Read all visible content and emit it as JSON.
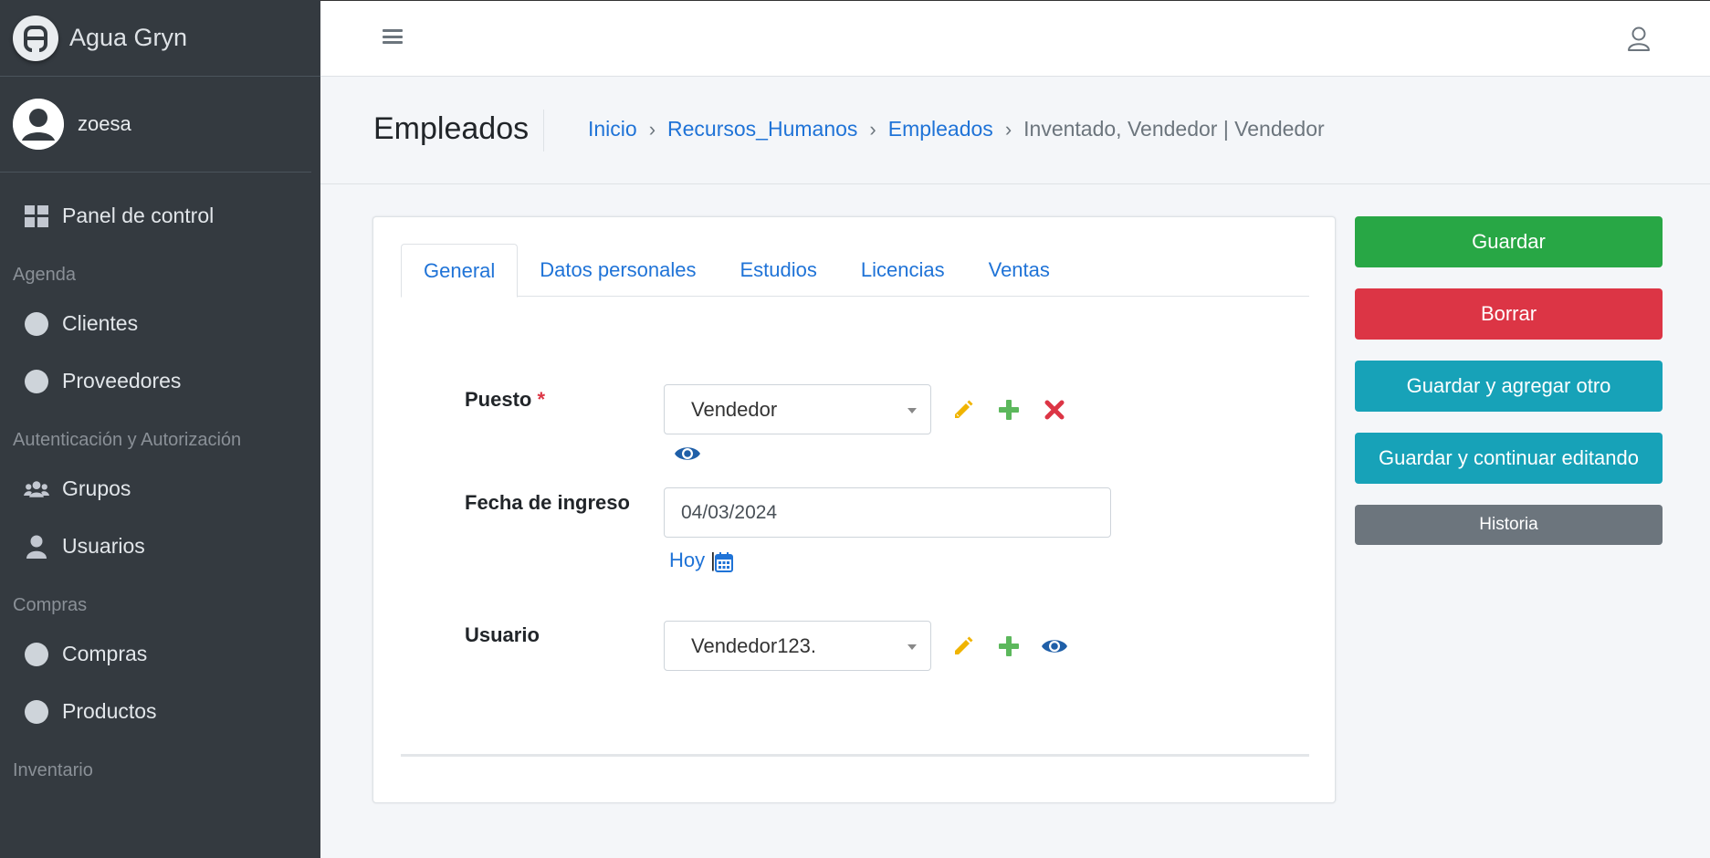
{
  "app": {
    "brand_name": "Agua Gryn",
    "user_name": "zoesa"
  },
  "sidebar": {
    "dashboard_label": "Panel de control",
    "sections": [
      {
        "header": "Agenda",
        "items": [
          "Clientes",
          "Proveedores"
        ]
      },
      {
        "header": "Autenticación y Autorización",
        "items": [
          "Grupos",
          "Usuarios"
        ]
      },
      {
        "header": "Compras",
        "items": [
          "Compras",
          "Productos"
        ]
      },
      {
        "header": "Inventario"
      }
    ]
  },
  "page": {
    "title": "Empleados"
  },
  "breadcrumb": [
    "Inicio",
    "Recursos_Humanos",
    "Empleados",
    "Inventado, Vendedor | Vendedor"
  ],
  "tabs": [
    "General",
    "Datos personales",
    "Estudios",
    "Licencias",
    "Ventas"
  ],
  "form": {
    "puesto": {
      "label": "Puesto",
      "required_mark": "*",
      "value": "Vendedor"
    },
    "fecha_ingreso": {
      "label": "Fecha de ingreso",
      "value": "04/03/2024",
      "today_label": "Hoy",
      "separator": "|"
    },
    "usuario": {
      "label": "Usuario",
      "value": "Vendedor123."
    }
  },
  "actions": {
    "save": "Guardar",
    "delete": "Borrar",
    "save_add": "Guardar y agregar otro",
    "save_continue": "Guardar y continuar editando",
    "history": "Historia"
  },
  "colors": {
    "sidebar_bg": "#343a40",
    "link": "#1f73d7",
    "success": "#28a745",
    "danger": "#dc3545",
    "info": "#17a2b8",
    "secondary": "#6c757d",
    "edit_icon": "#f0b400",
    "add_icon": "#5cb85c",
    "delete_icon": "#dc3545",
    "view_icon": "#1f5fa8"
  }
}
